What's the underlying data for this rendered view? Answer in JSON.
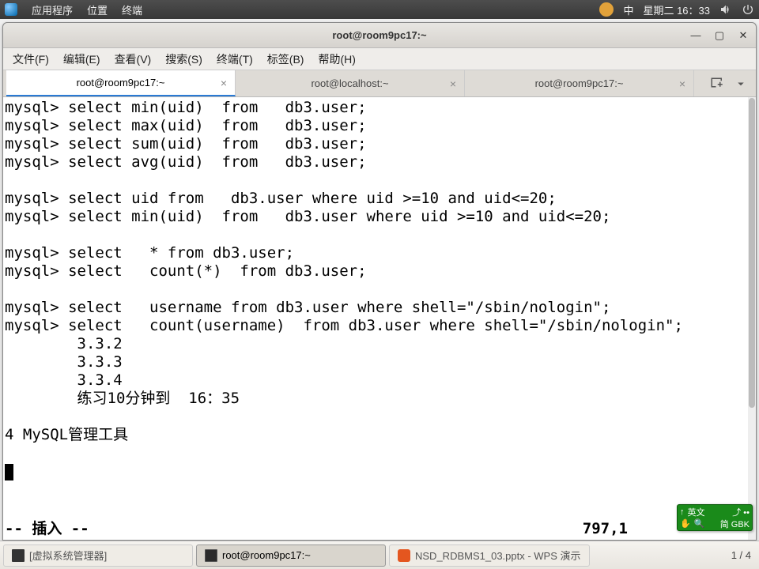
{
  "sysbar": {
    "apps": "应用程序",
    "places": "位置",
    "terminal": "终端",
    "ime": "中",
    "datetime": "星期二 16：33"
  },
  "window": {
    "title": "root@room9pc17:~"
  },
  "menu": {
    "file": "文件(F)",
    "edit": "编辑(E)",
    "view": "查看(V)",
    "search": "搜索(S)",
    "terminal": "终端(T)",
    "tabs": "标签(B)",
    "help": "帮助(H)"
  },
  "tabs": [
    {
      "label": "root@room9pc17:~",
      "active": true
    },
    {
      "label": "root@localhost:~",
      "active": false
    },
    {
      "label": "root@room9pc17:~",
      "active": false
    }
  ],
  "terminal_lines": [
    "mysql> select min(uid)  from   db3.user;",
    "mysql> select max(uid)  from   db3.user;",
    "mysql> select sum(uid)  from   db3.user;",
    "mysql> select avg(uid)  from   db3.user;",
    "",
    "mysql> select uid from   db3.user where uid >=10 and uid<=20;",
    "mysql> select min(uid)  from   db3.user where uid >=10 and uid<=20;",
    "",
    "mysql> select   * from db3.user;",
    "mysql> select   count(*)  from db3.user;",
    "",
    "mysql> select   username from db3.user where shell=\"/sbin/nologin\";",
    "mysql> select   count(username)  from db3.user where shell=\"/sbin/nologin\";",
    "        3.3.2",
    "        3.3.3",
    "        3.3.4",
    "        练习10分钟到  16：35",
    "",
    "4 MySQL管理工具",
    "",
    ""
  ],
  "status": {
    "mode": "-- 插入 --",
    "pos": "797,1"
  },
  "ime_badge": {
    "line1_a": "↑",
    "line1_b": "英文",
    "line1_c": "⤴ ••",
    "line2_a": "✋",
    "line2_b": "🔍",
    "line2_c": "简 GBK"
  },
  "taskbar": {
    "tasks": [
      {
        "label": "[虚拟系统管理器]",
        "icon": "vm",
        "active": false
      },
      {
        "label": "root@room9pc17:~",
        "icon": "term",
        "active": true
      },
      {
        "label": "NSD_RDBMS1_03.pptx - WPS 演示",
        "icon": "wps",
        "active": false
      }
    ],
    "wscount": "1 / 4"
  }
}
